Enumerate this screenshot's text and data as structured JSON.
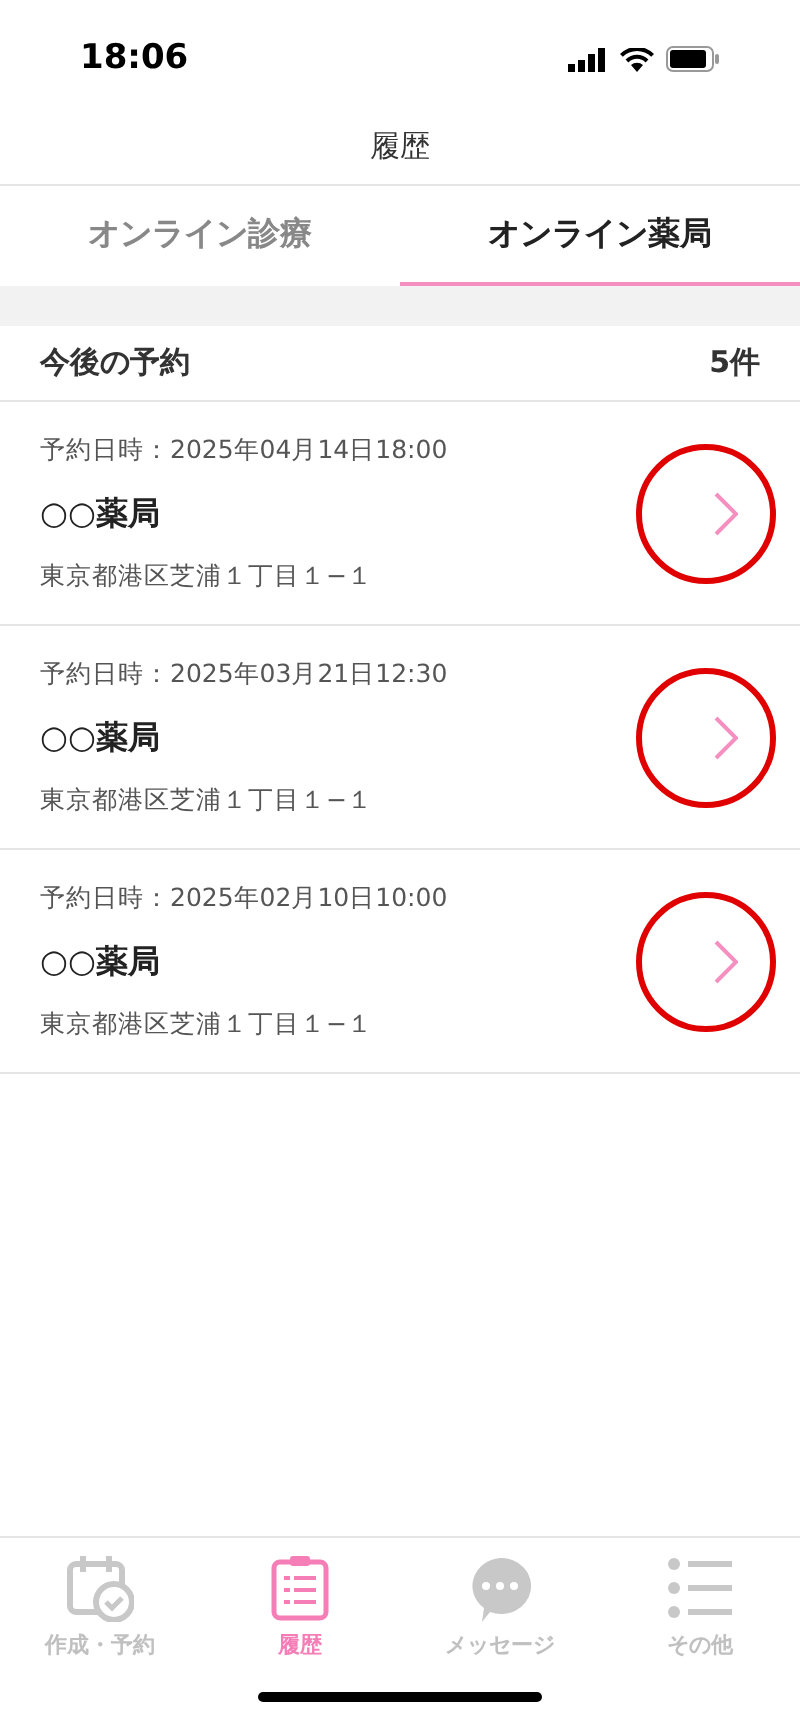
{
  "status_bar": {
    "time": "18:06"
  },
  "header": {
    "title": "履歴"
  },
  "tabs": [
    {
      "label": "オンライン診療",
      "selected": false
    },
    {
      "label": "オンライン薬局",
      "selected": true
    }
  ],
  "section": {
    "title": "今後の予約",
    "count": "5件"
  },
  "reservations": [
    {
      "datetime": "予約日時：2025年04月14日18:00",
      "name": "○○薬局",
      "address": "東京都港区芝浦１丁目１−１",
      "highlighted": true
    },
    {
      "datetime": "予約日時：2025年03月21日12:30",
      "name": "○○薬局",
      "address": "東京都港区芝浦１丁目１−１",
      "highlighted": true
    },
    {
      "datetime": "予約日時：2025年02月10日10:00",
      "name": "○○薬局",
      "address": "東京都港区芝浦１丁目１−１",
      "highlighted": true
    }
  ],
  "tab_bar": [
    {
      "kind": "calendar",
      "label": "作成・予約",
      "selected": false
    },
    {
      "kind": "clipboard",
      "label": "履歴",
      "selected": true
    },
    {
      "kind": "chat",
      "label": "メッセージ",
      "selected": false
    },
    {
      "kind": "list",
      "label": "その他",
      "selected": false
    }
  ]
}
